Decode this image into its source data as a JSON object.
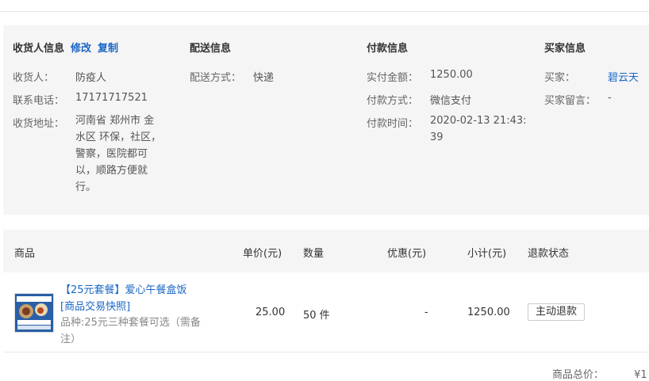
{
  "receiver": {
    "title": "收货人信息",
    "edit_label": "修改",
    "copy_label": "复制",
    "name_label": "收货人：",
    "name_value": "防疫人",
    "phone_label": "联系电话：",
    "phone_value": "17171717521",
    "address_label": "收货地址：",
    "address_value": "河南省 郑州市 金水区 环保，社区，警察，医院都可以，顺路方便就行。"
  },
  "delivery": {
    "title": "配送信息",
    "method_label": "配送方式：",
    "method_value": "快递"
  },
  "payment": {
    "title": "付款信息",
    "amount_label": "实付金额：",
    "amount_value": "1250.00",
    "method_label": "付款方式：",
    "method_value": "微信支付",
    "time_label": "付款时间：",
    "time_value": "2020-02-13 21:43:39"
  },
  "buyer": {
    "title": "买家信息",
    "buyer_label": "买家：",
    "buyer_value": "碧云天",
    "note_label": "买家留言：",
    "note_value": "-"
  },
  "table": {
    "headers": {
      "product": "商品",
      "unit_price": "单价(元)",
      "quantity": "数量",
      "discount": "优惠(元)",
      "subtotal": "小计(元)",
      "refund_status": "退款状态"
    },
    "rows": [
      {
        "title": "【25元套餐】爱心午餐盒饭",
        "snapshot": "[商品交易快照]",
        "spec": "品种:25元三种套餐可选（需备注）",
        "unit_price": "25.00",
        "quantity": "50 件",
        "discount": "-",
        "subtotal": "1250.00",
        "refund_button": "主动退款"
      }
    ]
  },
  "summary": {
    "total_label": "商品总价：",
    "total_value": "¥1"
  }
}
